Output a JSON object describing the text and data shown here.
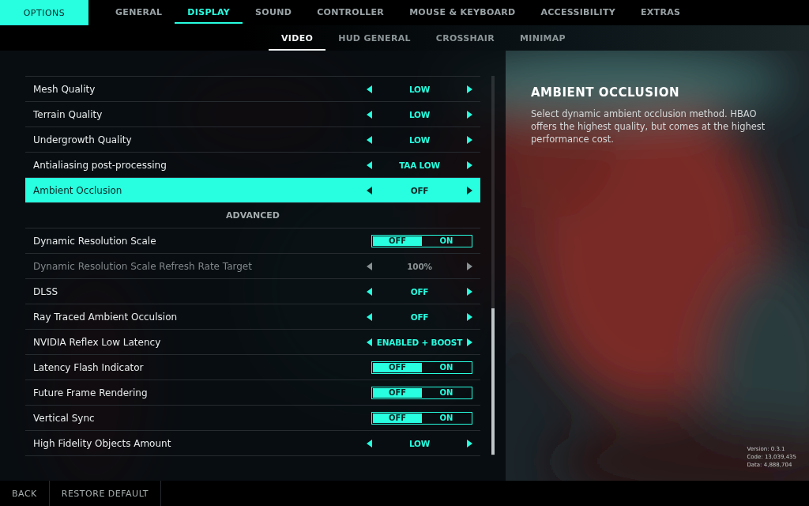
{
  "header": {
    "title": "OPTIONS"
  },
  "tabs": [
    {
      "label": "GENERAL",
      "selected": false
    },
    {
      "label": "DISPLAY",
      "selected": true
    },
    {
      "label": "SOUND",
      "selected": false
    },
    {
      "label": "CONTROLLER",
      "selected": false
    },
    {
      "label": "MOUSE & KEYBOARD",
      "selected": false
    },
    {
      "label": "ACCESSIBILITY",
      "selected": false
    },
    {
      "label": "EXTRAS",
      "selected": false
    }
  ],
  "subtabs": [
    {
      "label": "VIDEO",
      "selected": true
    },
    {
      "label": "HUD GENERAL",
      "selected": false
    },
    {
      "label": "CROSSHAIR",
      "selected": false
    },
    {
      "label": "MINIMAP",
      "selected": false
    }
  ],
  "settings": [
    {
      "kind": "selector",
      "label": "Mesh Quality",
      "value": "LOW",
      "selected": false,
      "disabled": false
    },
    {
      "kind": "selector",
      "label": "Terrain Quality",
      "value": "LOW",
      "selected": false,
      "disabled": false
    },
    {
      "kind": "selector",
      "label": "Undergrowth Quality",
      "value": "LOW",
      "selected": false,
      "disabled": false
    },
    {
      "kind": "selector",
      "label": "Antialiasing post-processing",
      "value": "TAA LOW",
      "selected": false,
      "disabled": false
    },
    {
      "kind": "selector",
      "label": "Ambient Occlusion",
      "value": "OFF",
      "selected": true,
      "disabled": false
    },
    {
      "kind": "section",
      "label": "ADVANCED"
    },
    {
      "kind": "toggle",
      "label": "Dynamic Resolution Scale",
      "off_label": "OFF",
      "on_label": "ON",
      "on": false,
      "selected": false,
      "disabled": false
    },
    {
      "kind": "selector",
      "label": "Dynamic Resolution Scale Refresh Rate Target",
      "value": "100%",
      "selected": false,
      "disabled": true
    },
    {
      "kind": "selector",
      "label": "DLSS",
      "value": "OFF",
      "selected": false,
      "disabled": false
    },
    {
      "kind": "selector",
      "label": "Ray Traced Ambient Occulsion",
      "value": "OFF",
      "selected": false,
      "disabled": false
    },
    {
      "kind": "selector",
      "label": "NVIDIA Reflex Low Latency",
      "value": "ENABLED + BOOST",
      "selected": false,
      "disabled": false
    },
    {
      "kind": "toggle",
      "label": "Latency Flash Indicator",
      "off_label": "OFF",
      "on_label": "ON",
      "on": false,
      "selected": false,
      "disabled": false
    },
    {
      "kind": "toggle",
      "label": "Future Frame Rendering",
      "off_label": "OFF",
      "on_label": "ON",
      "on": false,
      "selected": false,
      "disabled": false
    },
    {
      "kind": "toggle",
      "label": "Vertical Sync",
      "off_label": "OFF",
      "on_label": "ON",
      "on": false,
      "selected": false,
      "disabled": false
    },
    {
      "kind": "selector",
      "label": "High Fidelity Objects Amount",
      "value": "LOW",
      "selected": false,
      "disabled": false
    }
  ],
  "description": {
    "title": "AMBIENT OCCLUSION",
    "text": "Select dynamic ambient occlusion method. HBAO offers the highest quality, but comes at the highest performance cost."
  },
  "build_info": [
    "Version: 0.3.1",
    "Code: 13,039,435",
    "Data: 4,888,704"
  ],
  "footer": [
    "BACK",
    "RESTORE DEFAULT"
  ]
}
